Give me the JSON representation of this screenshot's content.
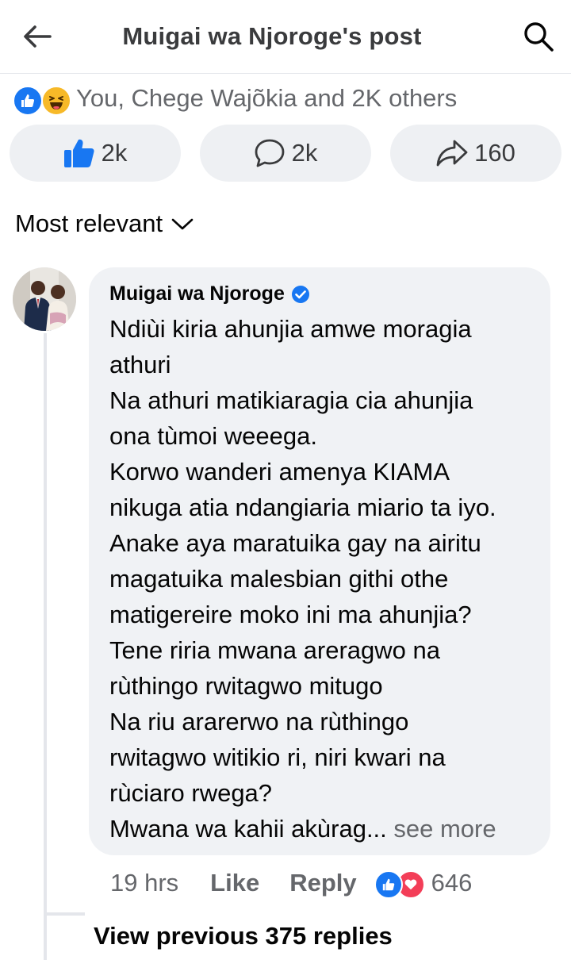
{
  "header": {
    "title": "Muigai wa Njoroge's post",
    "back_icon": "arrow-left-icon",
    "search_icon": "search-icon"
  },
  "reactions": {
    "summary": "You, Chege Wajõkia and 2K others",
    "icons": [
      "like-reaction-icon",
      "haha-reaction-icon"
    ],
    "colors": {
      "like": "#1877f2",
      "haha": "#f7b928",
      "love": "#f33e58"
    }
  },
  "actions": {
    "like_count": "2k",
    "comment_count": "2k",
    "share_count": "160"
  },
  "sort": {
    "label": "Most relevant"
  },
  "comment": {
    "author": "Muigai wa Njoroge",
    "lines": [
      "Ndiùi kiria ahunjia amwe moragia",
      "athuri",
      "Na athuri matikiaragia cia ahunjia",
      "ona tùmoi weeega.",
      "Korwo wanderi amenya KIAMA",
      "nikuga atia ndangiaria miario ta iyo.",
      "Anake aya maratuika gay na airitu",
      "magatuika malesbian githi othe",
      "matigereire moko ini ma ahunjia?",
      "Tene riria mwana areragwo na",
      "rùthingo rwitagwo mitugo",
      "Na riu ararerwo na rùthingo",
      "rwitagwo witikio ri, niri kwari na",
      "rùciaro rwega?"
    ],
    "truncated_line": "Mwana wa kahii akùrag...",
    "see_more": " see more",
    "time": "19 hrs",
    "like_label": "Like",
    "reply_label": "Reply",
    "reaction_count": "646"
  },
  "replies": {
    "view_previous": "View previous 375 replies"
  }
}
